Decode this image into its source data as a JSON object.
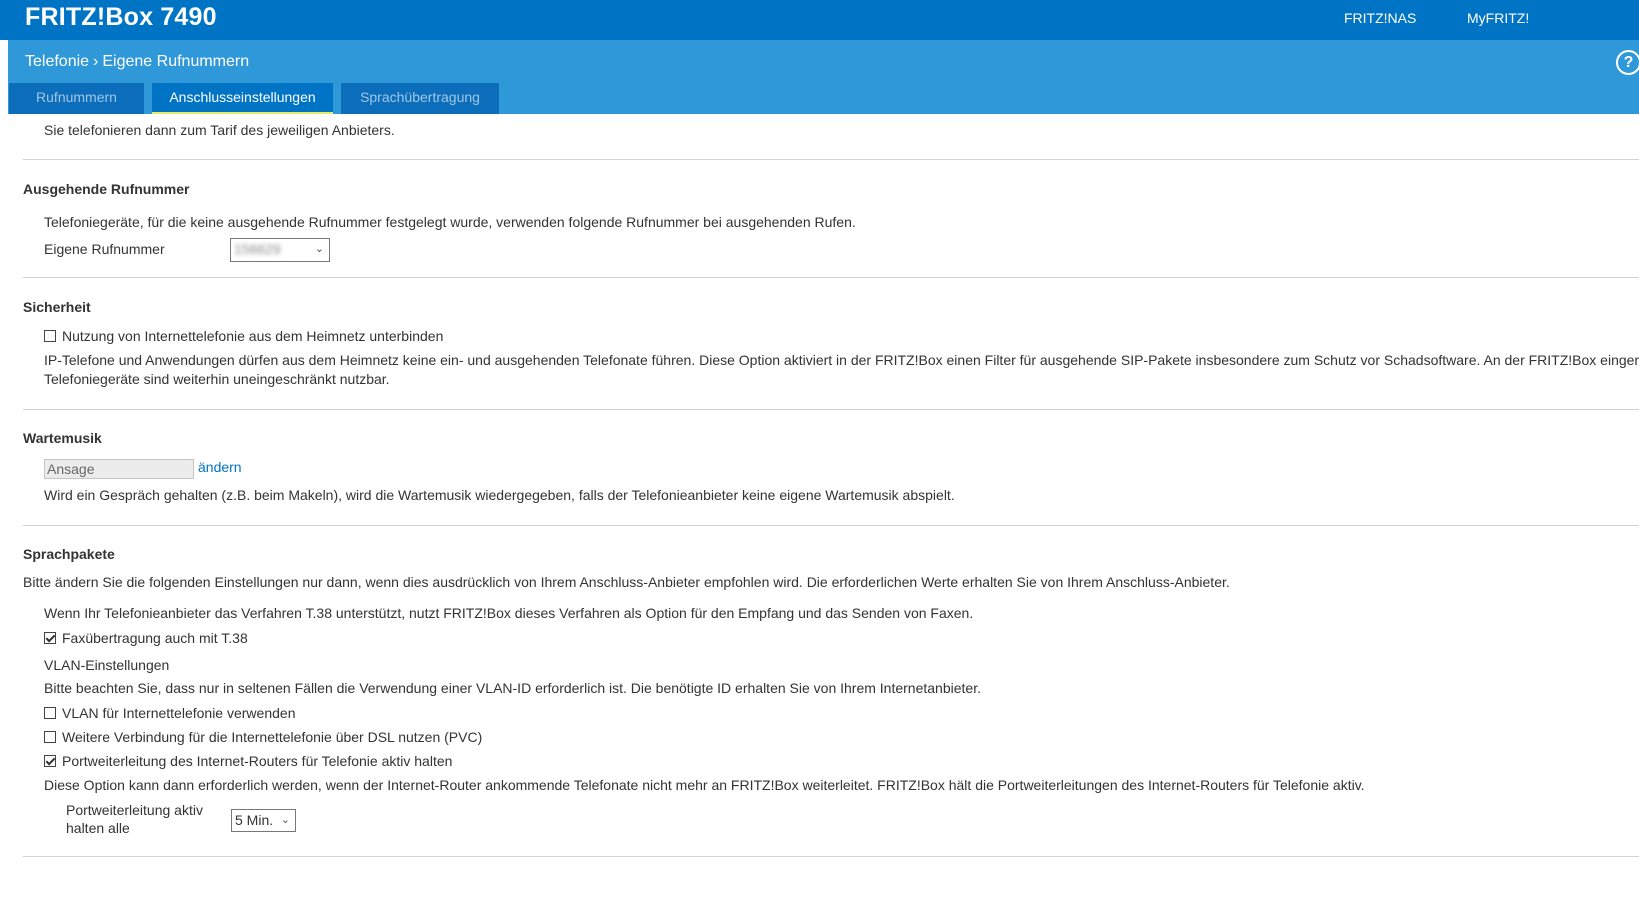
{
  "header": {
    "brand": "FRITZ!Box 7490",
    "links": [
      "FRITZ!NAS",
      "MyFRITZ!"
    ],
    "help": "?"
  },
  "breadcrumb": {
    "section": "Telefonie",
    "page": "Eigene Rufnummern"
  },
  "tabs": [
    "Rufnummern",
    "Anschlusseinstellungen",
    "Sprachübertragung"
  ],
  "active_tab": "Anschlusseinstellungen",
  "intro_text": "Sie telefonieren dann zum Tarif des jeweiligen Anbieters.",
  "outgoing": {
    "title": "Ausgehende Rufnummer",
    "description": "Telefoniegeräte, für die keine ausgehende Rufnummer festgelegt wurde, verwenden folgende Rufnummer bei ausgehenden Rufen.",
    "label": "Eigene Rufnummer",
    "value": "156629"
  },
  "security": {
    "title": "Sicherheit",
    "checkbox_label": "Nutzung von Internettelefonie aus dem Heimnetz unterbinden",
    "checked": false,
    "description_line1": "IP-Telefone und Anwendungen dürfen aus dem Heimnetz keine ein- und ausgehenden Telefonate führen. Diese Option aktiviert in der FRITZ!Box einen Filter für ausgehende SIP-Pakete insbesondere zum Schutz vor Schadsoftware. An der FRITZ!Box eingerichtete",
    "description_line2": "Telefoniegeräte sind weiterhin uneingeschränkt nutzbar."
  },
  "hold_music": {
    "title": "Wartemusik",
    "value": "Ansage",
    "change_link": "ändern",
    "description": "Wird ein Gespräch gehalten (z.B. beim Makeln), wird die Wartemusik wiedergegeben, falls der Telefonieanbieter keine eigene Wartemusik abspielt."
  },
  "voice_packets": {
    "title": "Sprachpakete",
    "note": "Bitte ändern Sie die folgenden Einstellungen nur dann, wenn dies ausdrücklich von Ihrem Anschluss-Anbieter empfohlen wird. Die erforderlichen Werte erhalten Sie von Ihrem Anschluss-Anbieter.",
    "t38_description": "Wenn Ihr Telefonieanbieter das Verfahren T.38 unterstützt, nutzt FRITZ!Box dieses Verfahren als Option für den Empfang und das Senden von Faxen.",
    "t38_label": "Faxübertragung auch mit T.38",
    "t38_checked": true,
    "vlan_title": "VLAN-Einstellungen",
    "vlan_description": "Bitte beachten Sie, dass nur in seltenen Fällen die Verwendung einer VLAN-ID erforderlich ist. Die benötigte ID erhalten Sie von Ihrem Internetanbieter.",
    "vlan_label": "VLAN für Internettelefonie verwenden",
    "vlan_checked": false,
    "pvc_label": "Weitere Verbindung für die Internettelefonie über DSL nutzen (PVC)",
    "pvc_checked": false,
    "portfwd_label": "Portweiterleitung des Internet-Routers für Telefonie aktiv halten",
    "portfwd_checked": true,
    "portfwd_description": "Diese Option kann dann erforderlich werden, wenn der Internet-Router ankommende Telefonate nicht mehr an FRITZ!Box weiterleitet. FRITZ!Box hält die Portweiterleitungen des Internet-Routers für Telefonie aktiv.",
    "interval_label_line1": "Portweiterleitung aktiv",
    "interval_label_line2": "halten alle",
    "interval_value": "5 Min."
  }
}
